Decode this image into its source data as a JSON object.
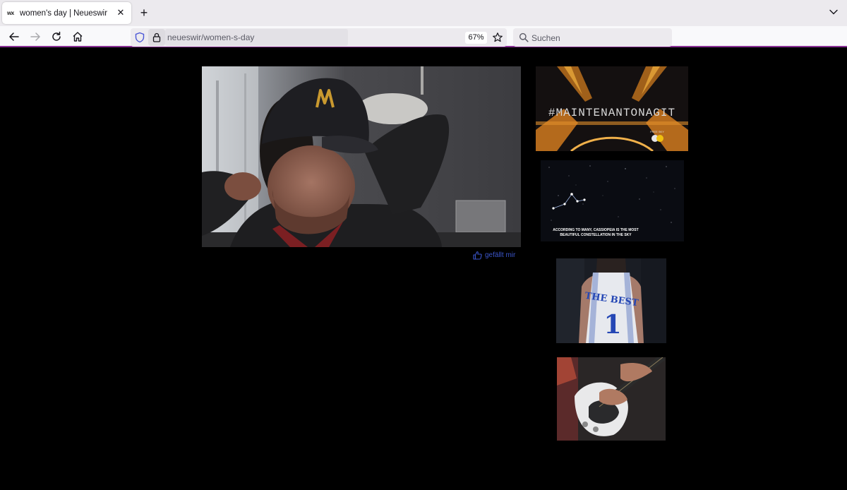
{
  "browser": {
    "tab": {
      "favicon_text": "wx",
      "title": "women's day | Neueswir",
      "close_glyph": "✕"
    },
    "new_tab_glyph": "+",
    "url": "neueswir/women-s-day",
    "zoom": "67%",
    "search_placeholder": "Suchen",
    "accent_color": "#8a2f95"
  },
  "page": {
    "like_label": "gefällt mir",
    "like_color": "#3b55c9",
    "thumbnails": [
      {
        "overlay_text": "#MAINTENANTONAGIT",
        "badge_text": "FREE SKY"
      },
      {
        "caption_line1": "ACCORDING TO MANY, CASSIOPEIA IS THE MOST",
        "caption_line2": "BEAUTIFUL CONSTELLATION IN THE SKY"
      },
      {
        "jersey_text": "THE BEST",
        "jersey_number": "1"
      },
      {
        "subject": "guitar"
      }
    ]
  }
}
